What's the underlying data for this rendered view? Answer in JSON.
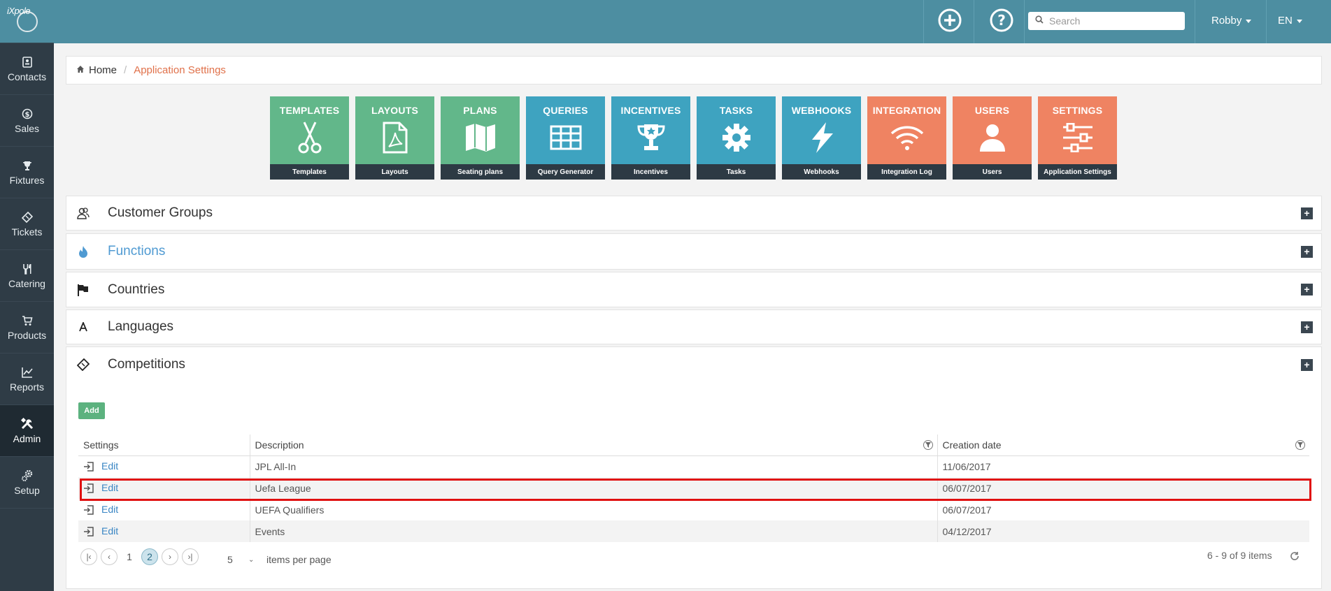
{
  "sidebar": {
    "logo_text": "iXpole",
    "items": [
      {
        "label": "Contacts",
        "icon": "contact-card-icon"
      },
      {
        "label": "Sales",
        "icon": "dollar-icon"
      },
      {
        "label": "Fixtures",
        "icon": "trophy-icon"
      },
      {
        "label": "Tickets",
        "icon": "ticket-icon"
      },
      {
        "label": "Catering",
        "icon": "utensils-icon"
      },
      {
        "label": "Products",
        "icon": "cart-icon"
      },
      {
        "label": "Reports",
        "icon": "chart-icon"
      },
      {
        "label": "Admin",
        "icon": "tools-icon",
        "active": true
      },
      {
        "label": "Setup",
        "icon": "gears-icon"
      }
    ]
  },
  "topbar": {
    "search_placeholder": "Search",
    "user": "Robby",
    "language": "EN"
  },
  "breadcrumb": {
    "home": "Home",
    "current": "Application Settings"
  },
  "tiles": [
    {
      "title": "TEMPLATES",
      "footer": "Templates",
      "color": "#62b78a",
      "icon": "scissors-icon"
    },
    {
      "title": "LAYOUTS",
      "footer": "Layouts",
      "color": "#62b78a",
      "icon": "pdf-file-icon"
    },
    {
      "title": "PLANS",
      "footer": "Seating plans",
      "color": "#62b78a",
      "icon": "map-icon"
    },
    {
      "title": "QUERIES",
      "footer": "Query Generator",
      "color": "#3ea3c0",
      "icon": "table-icon"
    },
    {
      "title": "INCENTIVES",
      "footer": "Incentives",
      "color": "#3ea3c0",
      "icon": "trophy-icon"
    },
    {
      "title": "TASKS",
      "footer": "Tasks",
      "color": "#3ea3c0",
      "icon": "gear-icon"
    },
    {
      "title": "WEBHOOKS",
      "footer": "Webhooks",
      "color": "#3ea3c0",
      "icon": "lightning-icon"
    },
    {
      "title": "INTEGRATION",
      "footer": "Integration Log",
      "color": "#ef8362",
      "icon": "wifi-icon"
    },
    {
      "title": "USERS",
      "footer": "Users",
      "color": "#ef8362",
      "icon": "user-icon"
    },
    {
      "title": "SETTINGS",
      "footer": "Application Settings",
      "color": "#ef8362",
      "icon": "sliders-icon"
    }
  ],
  "accordions": [
    {
      "title": "Customer Groups",
      "icon": "users-group-icon"
    },
    {
      "title": "Functions",
      "icon": "fire-icon"
    },
    {
      "title": "Countries",
      "icon": "flag-icon"
    },
    {
      "title": "Languages",
      "icon": "font-icon"
    },
    {
      "title": "Competitions",
      "icon": "ticket-icon"
    }
  ],
  "competitions": {
    "add_label": "Add",
    "columns": [
      "Settings",
      "Description",
      "Creation date"
    ],
    "rows": [
      {
        "action": "Edit",
        "description": "JPL All-In",
        "date": "11/06/2017"
      },
      {
        "action": "Edit",
        "description": "Uefa League",
        "date": "06/07/2017",
        "highlighted": true
      },
      {
        "action": "Edit",
        "description": "UEFA Qualifiers",
        "date": "06/07/2017"
      },
      {
        "action": "Edit",
        "description": "Events",
        "date": "04/12/2017"
      }
    ],
    "pager": {
      "pages": [
        "1",
        "2"
      ],
      "current_page": "2",
      "page_size": "5",
      "per_page_label": "items per page",
      "info": "6 - 9 of 9 items"
    }
  },
  "colors": {
    "topbar": "#4d8ea1",
    "sidebar": "#2f3c46",
    "accent_orange": "#e0714a",
    "highlight_border": "#e01010"
  }
}
